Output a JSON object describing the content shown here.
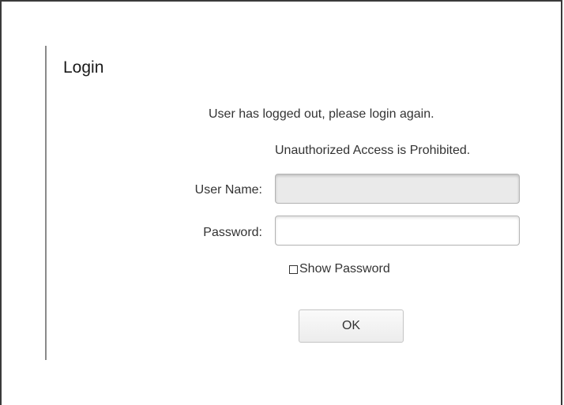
{
  "login": {
    "title": "Login",
    "logout_message": "User has logged out, please login again.",
    "warning_message": "Unauthorized Access is Prohibited.",
    "username_label": "User Name:",
    "username_value": "",
    "password_label": "Password:",
    "password_value": "",
    "show_password_label": "Show Password",
    "show_password_checked": false,
    "ok_label": "OK"
  }
}
